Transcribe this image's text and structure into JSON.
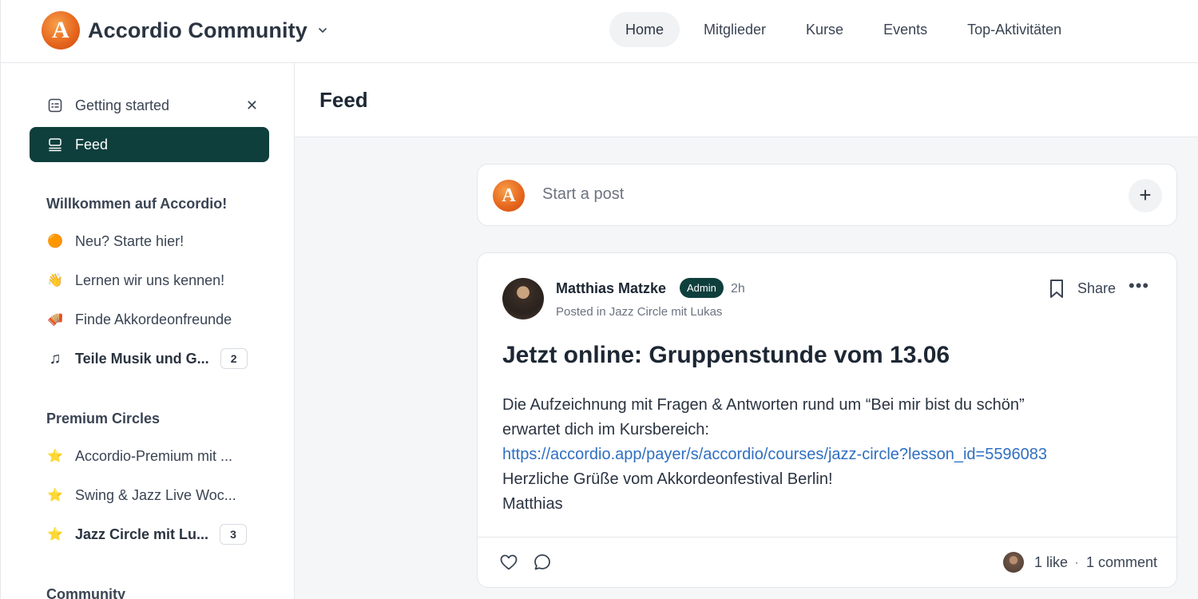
{
  "header": {
    "brand_letter": "A",
    "brand_name": "Accordio Community",
    "nav": [
      "Home",
      "Mitglieder",
      "Kurse",
      "Events",
      "Top-Aktivitäten"
    ],
    "active_nav": "Home"
  },
  "sidebar": {
    "getting_started": "Getting started",
    "feed": "Feed",
    "sections": [
      {
        "title": "Willkommen auf Accordio!",
        "items": [
          {
            "icon": "🟠",
            "label": "Neu? Starte hier!"
          },
          {
            "icon": "👋",
            "label": "Lernen wir uns kennen!"
          },
          {
            "icon": "🪗",
            "label": "Finde Akkordeonfreunde"
          },
          {
            "icon": "♫",
            "label": "Teile Musik und G...",
            "count": "2"
          }
        ]
      },
      {
        "title": "Premium Circles",
        "items": [
          {
            "icon": "⭐",
            "label": "Accordio-Premium mit ..."
          },
          {
            "icon": "⭐",
            "label": "Swing & Jazz Live Woc..."
          },
          {
            "icon": "⭐",
            "label": "Jazz Circle mit Lu...",
            "count": "3"
          }
        ]
      },
      {
        "title": "Community",
        "items": []
      }
    ]
  },
  "main": {
    "title": "Feed",
    "composer": {
      "avatar_letter": "A",
      "placeholder": "Start a post",
      "plus": "+"
    },
    "post": {
      "author": "Matthias Matzke",
      "badge": "Admin",
      "time": "2h",
      "posted_in": "Posted in Jazz Circle mit Lukas",
      "share": "Share",
      "more": "•••",
      "title": "Jetzt online: Gruppenstunde vom 13.06",
      "body_line1": "Die Aufzeichnung mit Fragen & Antworten rund um “Bei mir bist du schön”",
      "body_line2": "erwartet dich im Kursbereich:",
      "link": "https://accordio.app/payer/s/accordio/courses/jazz-circle?lesson_id=5596083",
      "body_line3": "Herzliche Grüße vom Akkordeonfestival Berlin!",
      "signoff": "Matthias",
      "likes": "1 like",
      "separator": "·",
      "comments": "1 comment"
    }
  },
  "colors": {
    "accent_dark_green": "#0e3f3d",
    "brand_orange": "#e5641c",
    "link_blue": "#2f6fc2"
  }
}
